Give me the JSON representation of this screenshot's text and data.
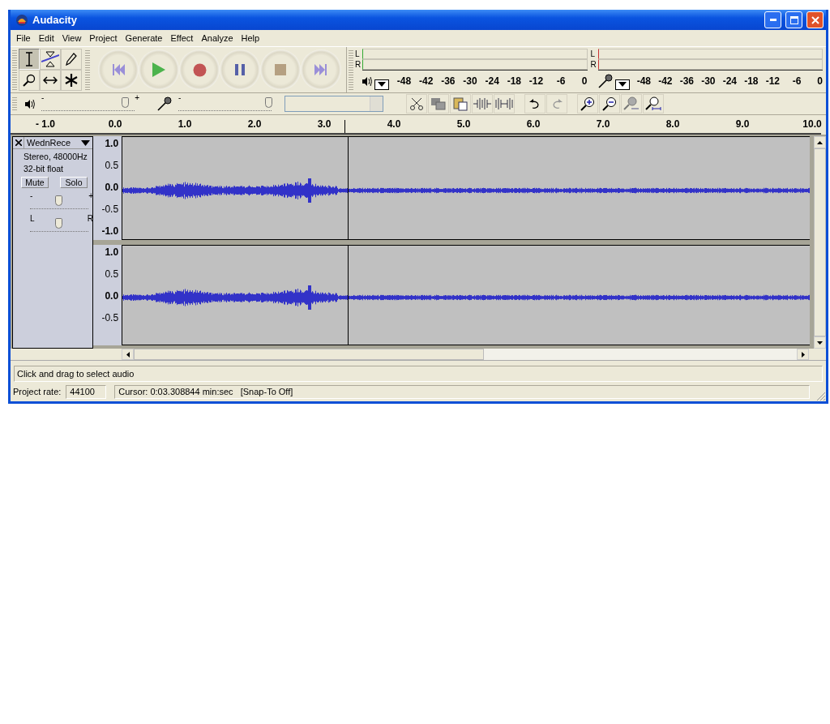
{
  "window": {
    "title": "Audacity"
  },
  "menu": [
    "File",
    "Edit",
    "View",
    "Project",
    "Generate",
    "Effect",
    "Analyze",
    "Help"
  ],
  "tools": [
    {
      "kind": "select",
      "selected": true
    },
    {
      "kind": "envelope",
      "selected": false
    },
    {
      "kind": "draw",
      "selected": false
    },
    {
      "kind": "zoom",
      "selected": false
    },
    {
      "kind": "timeshift",
      "selected": false
    },
    {
      "kind": "multi",
      "selected": false
    }
  ],
  "meters": [
    {
      "kind": "playback",
      "channels": [
        "L",
        "R"
      ],
      "scale": [
        "-48",
        "-42",
        "-36",
        "-30",
        "-24",
        "-18",
        "-12",
        "-6",
        "0"
      ]
    },
    {
      "kind": "recording",
      "channels": [
        "L",
        "R"
      ],
      "scale": [
        "-48",
        "-42",
        "-36",
        "-30",
        "-24",
        "-18",
        "-12",
        "-6",
        "0"
      ]
    }
  ],
  "mixer": {
    "playback": {
      "min": "-",
      "max": "+",
      "level": 0.9
    },
    "recording": {
      "min": "-",
      "level": 0.97
    }
  },
  "ruler": [
    "- 1.0",
    "0.0",
    "1.0",
    "2.0",
    "3.0",
    "4.0",
    "5.0",
    "6.0",
    "7.0",
    "8.0",
    "9.0",
    "10.0"
  ],
  "track": {
    "name": "WednRece",
    "info": [
      "Stereo, 48000Hz",
      "32-bit float"
    ],
    "mute": "Mute",
    "solo": "Solo",
    "gain": {
      "min": "-",
      "max": "+",
      "level": 0.5
    },
    "pan": {
      "min": "L",
      "max": "R",
      "level": 0.5
    },
    "channels": [
      {
        "scale": [
          "1.0",
          "0.5",
          "0.0",
          "-0.5",
          "-1.0"
        ]
      },
      {
        "scale": [
          "1.0",
          "0.5",
          "0.0",
          "-0.5"
        ]
      }
    ]
  },
  "status": "Click and drag to select audio",
  "project_rate_label": "Project rate:",
  "project_rate": "44100",
  "cursor": "Cursor: 0:03.308844 min:sec   [Snap-To Off]"
}
